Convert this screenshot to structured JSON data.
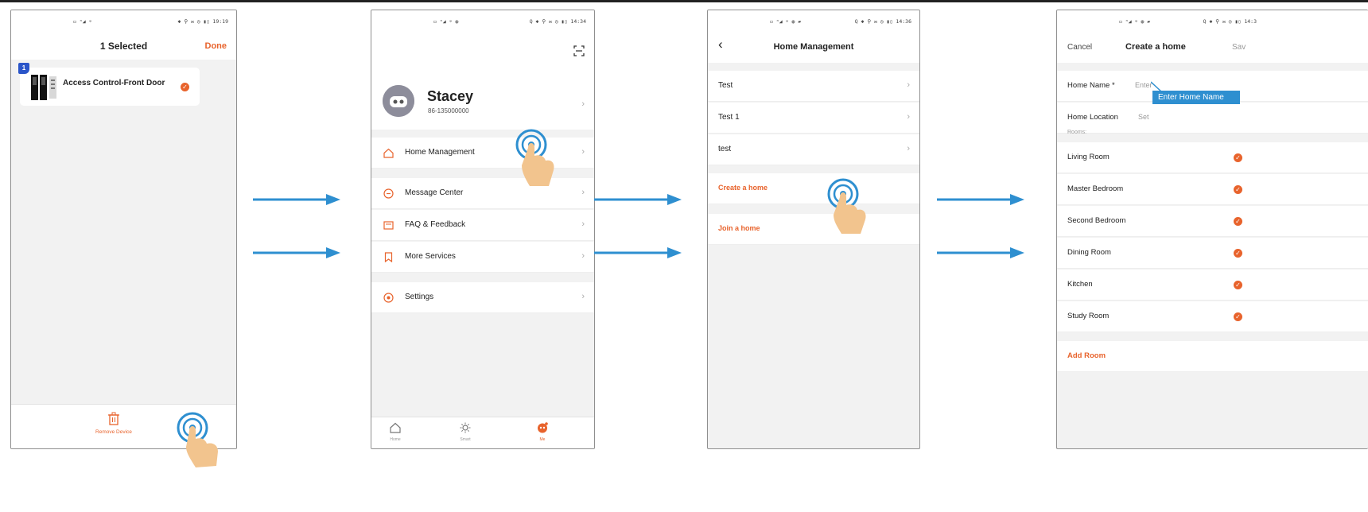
{
  "steps": [
    {
      "status": {
        "left": "▭ ⁿ◢ ⌔",
        "right": "✱ ⚲ ✉ ◷ ▮▯ 19:19"
      },
      "header": {
        "title": "1 Selected",
        "done_label": "Done"
      },
      "device": {
        "badge": "1",
        "name": "Access Control-Front Door"
      },
      "bottom_action": {
        "label": "Remove Device"
      }
    },
    {
      "status": {
        "left": "▭ ⁿ◢ ⌔ ◍",
        "right": "Q ✱ ⚲ ✉ ◷ ▮▯ 14:34"
      },
      "profile": {
        "name": "Stacey",
        "phone": "86-135000000"
      },
      "menu": [
        {
          "label": "Home Management",
          "icon": "home-icon"
        },
        {
          "label": "Message Center",
          "icon": "message-icon"
        },
        {
          "label": "FAQ & Feedback",
          "icon": "feedback-icon"
        },
        {
          "label": "More Services",
          "icon": "bookmark-icon"
        },
        {
          "label": "Settings",
          "icon": "settings-icon"
        }
      ],
      "tabs": [
        {
          "label": "Home",
          "icon": "home-tab-icon"
        },
        {
          "label": "Smart",
          "icon": "sun-icon"
        },
        {
          "label": "Me",
          "icon": "me-icon"
        }
      ]
    },
    {
      "status": {
        "left": "▭ ⁿ◢ ⌔ ◍ ▰",
        "right": "Q ✱ ⚲ ✉ ◷ ▮▯ 14:36"
      },
      "header": {
        "title": "Home Management",
        "back_glyph": "‹"
      },
      "homes": [
        "Test",
        "Test 1",
        "test"
      ],
      "actions": [
        "Create a home",
        "Join a home"
      ]
    },
    {
      "status": {
        "left": "▭ ⁿ◢ ⌔ ◍ ▰",
        "right": "Q ✱ ⚲ ✉ ◷ ▮▯ 14:3"
      },
      "header": {
        "cancel_label": "Cancel",
        "title": "Create a home",
        "save_label": "Sav"
      },
      "fields": [
        {
          "label": "Home Name *",
          "value": "Enter"
        },
        {
          "label": "Home Location",
          "value": "Set"
        }
      ],
      "callout": "Enter Home Name",
      "rooms_header": "Rooms:",
      "rooms": [
        "Living Room",
        "Master Bedroom",
        "Second Bedroom",
        "Dining Room",
        "Kitchen",
        "Study Room"
      ],
      "add_room_label": "Add Room"
    }
  ],
  "colors": {
    "accent": "#e8632c",
    "arrow": "#2e8fd0",
    "badge": "#2a55c9",
    "tap_ring": "#2e8fd0",
    "hand": "#f2c48e"
  }
}
